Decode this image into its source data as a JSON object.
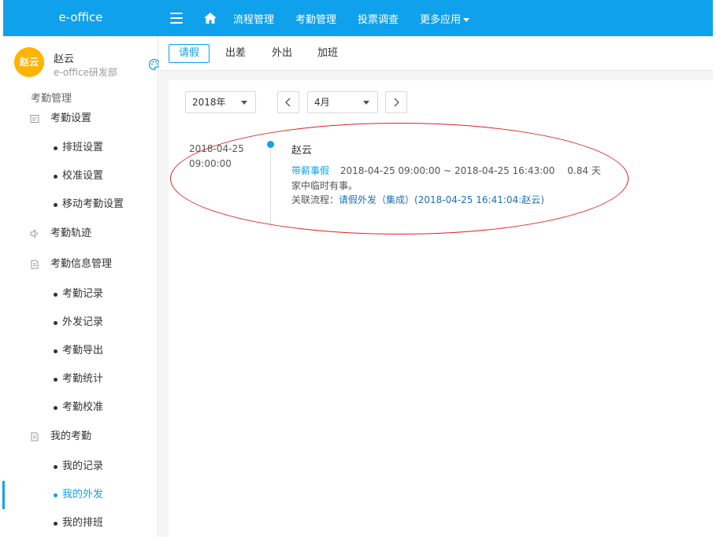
{
  "app": {
    "brand": "e-office"
  },
  "topnav": {
    "items": [
      "流程管理",
      "考勤管理",
      "投票调查",
      "更多应用"
    ]
  },
  "user": {
    "avatar_text": "赵云",
    "name": "赵云",
    "dept": "e-office研发部"
  },
  "sidebar": {
    "section": "考勤管理",
    "groups": [
      {
        "label": "考勤设置",
        "items": [
          "排班设置",
          "校准设置",
          "移动考勤设置"
        ]
      },
      {
        "label": "考勤轨迹",
        "items": []
      },
      {
        "label": "考勤信息管理",
        "items": [
          "考勤记录",
          "外发记录",
          "考勤导出",
          "考勤统计",
          "考勤校准"
        ]
      },
      {
        "label": "我的考勤",
        "items": [
          "我的记录",
          "我的外发",
          "我的排班"
        ]
      }
    ],
    "active_item": "我的外发"
  },
  "tabs": [
    "请假",
    "出差",
    "外出",
    "加班"
  ],
  "filters": {
    "year": "2018年",
    "month": "4月"
  },
  "record": {
    "date": "2018-04-25",
    "time": "09:00:00",
    "name": "赵云",
    "type": "带薪事假",
    "range": "2018-04-25 09:00:00 ~ 2018-04-25 16:43:00",
    "days": "0.84 天",
    "reason": "家中临时有事。",
    "flow_label": "关联流程：",
    "flow_link": "请假外发（集成）(2018-04-25 16:41:04:赵云)"
  },
  "colors": {
    "accent": "#0fa1ec",
    "avatar": "#ffb400",
    "annotation": "#dd2222"
  }
}
